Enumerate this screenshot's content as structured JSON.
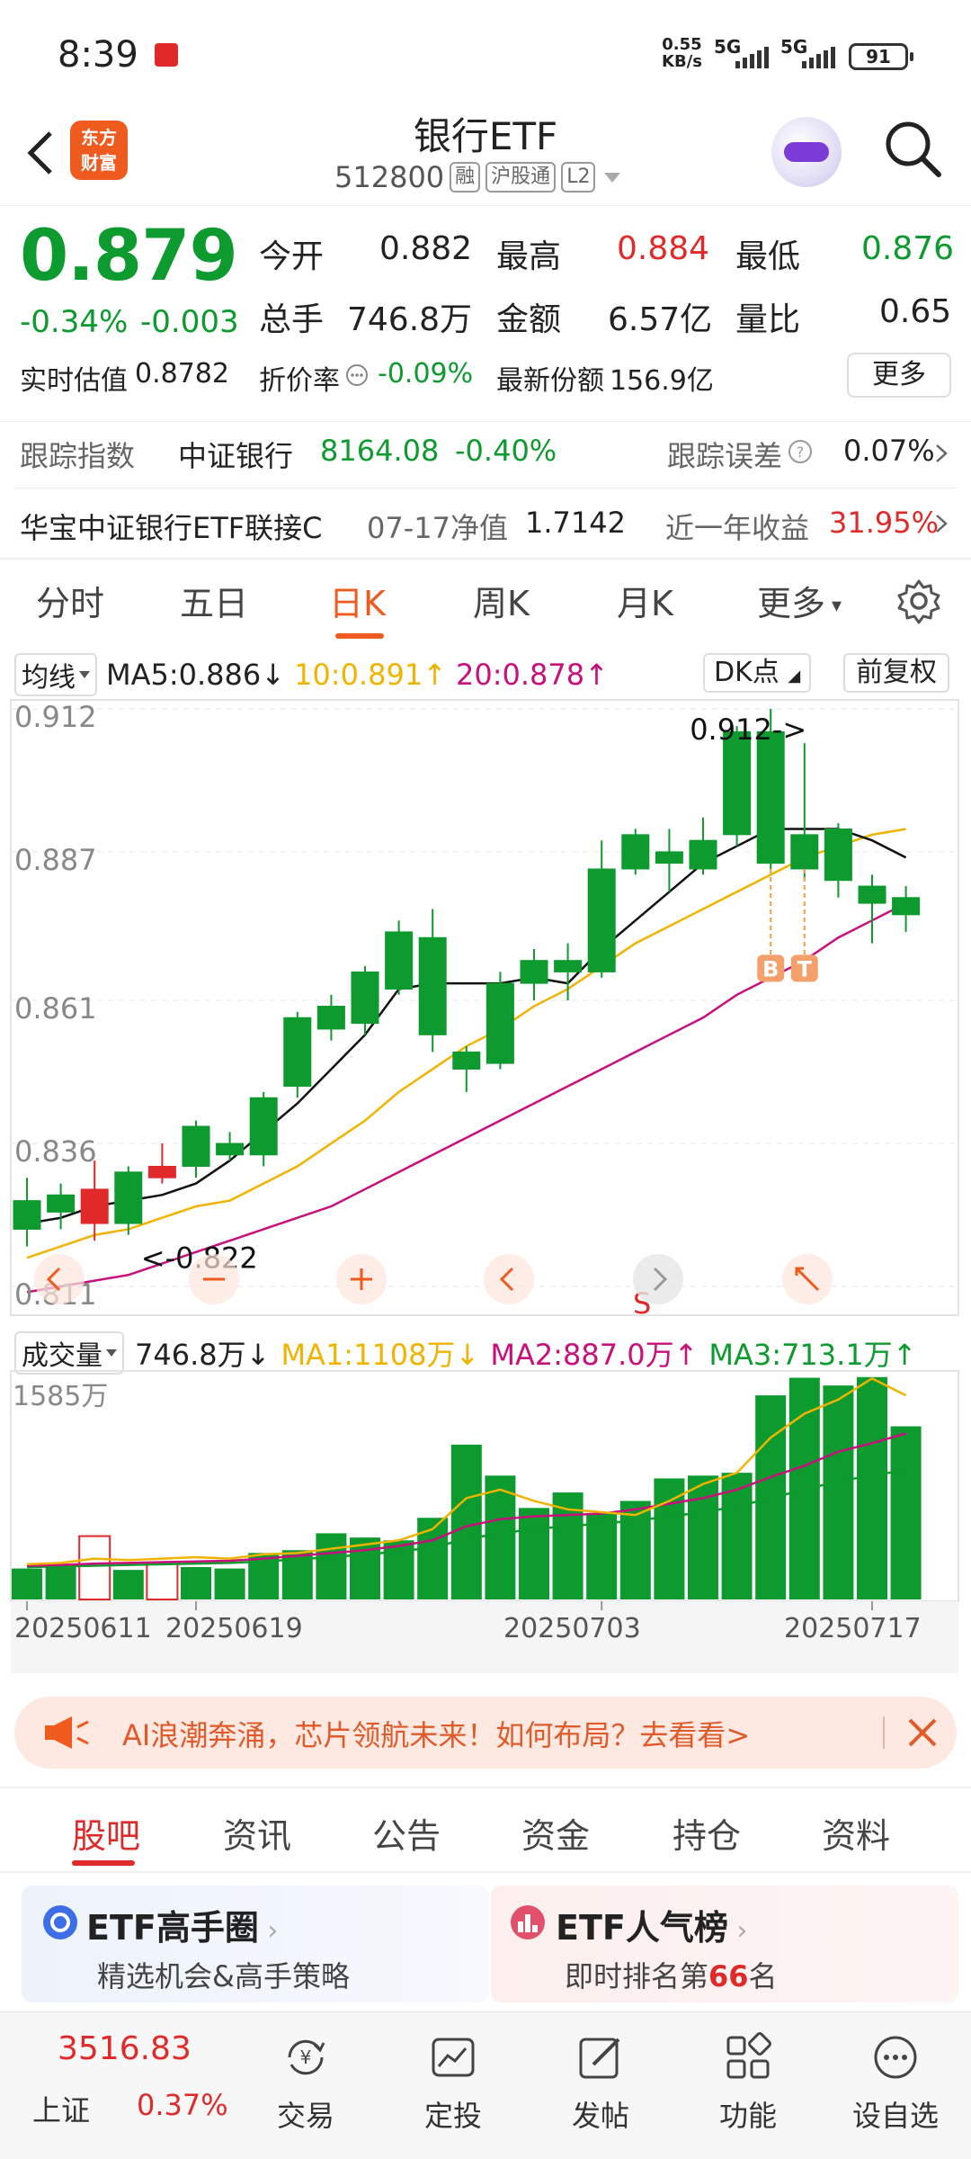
{
  "status_bar": {
    "time": "8:39",
    "net_speed": "0.55",
    "net_unit": "KB/s",
    "sig1": "5G",
    "sig2": "5G",
    "battery": "91"
  },
  "header": {
    "logo_line1": "东方",
    "logo_line2": "财富",
    "title": "银行ETF",
    "code": "512800",
    "tag_rong": "融",
    "tag_hgt": "沪股通",
    "tag_l2": "L2"
  },
  "quote": {
    "price": "0.879",
    "change_pct": "-0.34%",
    "change": "-0.003",
    "open_label": "今开",
    "open": "0.882",
    "high_label": "最高",
    "high": "0.884",
    "low_label": "最低",
    "low": "0.876",
    "volume_label": "总手",
    "volume": "746.8万",
    "amount_label": "金额",
    "amount": "6.57亿",
    "vol_ratio_label": "量比",
    "vol_ratio": "0.65",
    "iopv_label": "实时估值",
    "iopv": "0.8782",
    "premium_label": "折价率",
    "premium": "-0.09%",
    "shares_label": "最新份额",
    "shares": "156.9亿",
    "more": "更多"
  },
  "tracking": {
    "index_label": "跟踪指数",
    "index_name": "中证银行",
    "index_value": "8164.08",
    "index_change": "-0.40%",
    "error_label": "跟踪误差",
    "error_value": "0.07%",
    "fund_name": "华宝中证银行ETF联接C",
    "nav_date": "07-17净值",
    "nav": "1.7142",
    "yield_label": "近一年收益",
    "yield_value": "31.95%"
  },
  "ktabs": [
    "分时",
    "五日",
    "日K",
    "周K",
    "月K",
    "更多"
  ],
  "ma": {
    "select": "均线",
    "ma5": "MA5:0.886",
    "ma10": "10:0.891",
    "ma20": "20:0.878",
    "dk": "DK点",
    "fq": "前复权"
  },
  "vol_header": {
    "select": "成交量",
    "volume": "746.8万",
    "ma1": "MA1:1108万",
    "ma2": "MA2:887.0万",
    "ma3": "MA3:713.1万"
  },
  "chart_data": {
    "type": "candlestick",
    "price_axis": [
      "0.912",
      "0.887",
      "0.861",
      "0.836",
      "0.811"
    ],
    "annotations": {
      "high": "0.912->",
      "low": "<-0.822",
      "buy": "B",
      "take": "T",
      "sell": "S"
    },
    "dates": [
      "20250611",
      "20250619",
      "20250703",
      "20250717"
    ],
    "candles": [
      {
        "o": 0.826,
        "c": 0.821,
        "h": 0.83,
        "l": 0.818
      },
      {
        "o": 0.827,
        "c": 0.824,
        "h": 0.829,
        "l": 0.821
      },
      {
        "o": 0.822,
        "c": 0.828,
        "h": 0.833,
        "l": 0.819
      },
      {
        "o": 0.831,
        "c": 0.822,
        "h": 0.832,
        "l": 0.82
      },
      {
        "o": 0.83,
        "c": 0.832,
        "h": 0.836,
        "l": 0.829
      },
      {
        "o": 0.839,
        "c": 0.832,
        "h": 0.84,
        "l": 0.83
      },
      {
        "o": 0.836,
        "c": 0.834,
        "h": 0.838,
        "l": 0.833
      },
      {
        "o": 0.844,
        "c": 0.834,
        "h": 0.845,
        "l": 0.832
      },
      {
        "o": 0.858,
        "c": 0.846,
        "h": 0.859,
        "l": 0.844
      },
      {
        "o": 0.86,
        "c": 0.856,
        "h": 0.862,
        "l": 0.854
      },
      {
        "o": 0.866,
        "c": 0.857,
        "h": 0.867,
        "l": 0.855
      },
      {
        "o": 0.873,
        "c": 0.863,
        "h": 0.875,
        "l": 0.862
      },
      {
        "o": 0.872,
        "c": 0.855,
        "h": 0.877,
        "l": 0.852
      },
      {
        "o": 0.852,
        "c": 0.849,
        "h": 0.853,
        "l": 0.845
      },
      {
        "o": 0.864,
        "c": 0.85,
        "h": 0.866,
        "l": 0.849
      },
      {
        "o": 0.868,
        "c": 0.864,
        "h": 0.87,
        "l": 0.861
      },
      {
        "o": 0.868,
        "c": 0.866,
        "h": 0.871,
        "l": 0.861
      },
      {
        "o": 0.884,
        "c": 0.866,
        "h": 0.889,
        "l": 0.865
      },
      {
        "o": 0.89,
        "c": 0.884,
        "h": 0.891,
        "l": 0.883
      },
      {
        "o": 0.887,
        "c": 0.885,
        "h": 0.891,
        "l": 0.88
      },
      {
        "o": 0.889,
        "c": 0.884,
        "h": 0.893,
        "l": 0.883
      },
      {
        "o": 0.908,
        "c": 0.89,
        "h": 0.909,
        "l": 0.888
      },
      {
        "o": 0.908,
        "c": 0.885,
        "h": 0.912,
        "l": 0.884
      },
      {
        "o": 0.89,
        "c": 0.884,
        "h": 0.906,
        "l": 0.882
      },
      {
        "o": 0.891,
        "c": 0.882,
        "h": 0.892,
        "l": 0.879
      },
      {
        "o": 0.881,
        "c": 0.878,
        "h": 0.883,
        "l": 0.871
      },
      {
        "o": 0.879,
        "c": 0.876,
        "h": 0.881,
        "l": 0.873
      }
    ],
    "ma5": [
      0.822,
      0.823,
      0.825,
      0.826,
      0.827,
      0.829,
      0.833,
      0.838,
      0.843,
      0.849,
      0.855,
      0.863,
      0.864,
      0.864,
      0.864,
      0.865,
      0.864,
      0.87,
      0.875,
      0.88,
      0.885,
      0.888,
      0.891,
      0.891,
      0.891,
      0.889,
      0.886
    ],
    "ma10": [
      0.816,
      0.818,
      0.82,
      0.821,
      0.823,
      0.825,
      0.826,
      0.829,
      0.832,
      0.836,
      0.84,
      0.845,
      0.849,
      0.853,
      0.856,
      0.86,
      0.863,
      0.867,
      0.871,
      0.874,
      0.877,
      0.88,
      0.883,
      0.886,
      0.888,
      0.89,
      0.891
    ],
    "ma20": [
      0.81,
      0.811,
      0.812,
      0.813,
      0.815,
      0.817,
      0.819,
      0.821,
      0.823,
      0.825,
      0.828,
      0.831,
      0.834,
      0.837,
      0.84,
      0.843,
      0.846,
      0.849,
      0.852,
      0.855,
      0.858,
      0.862,
      0.865,
      0.868,
      0.872,
      0.875,
      0.878
    ],
    "volume_max_label": "1585万",
    "volume": [
      220,
      230,
      450,
      210,
      260,
      230,
      220,
      330,
      350,
      470,
      440,
      420,
      580,
      1100,
      880,
      650,
      760,
      610,
      700,
      860,
      880,
      900,
      1450,
      1575,
      1520,
      1580,
      1230
    ],
    "vol_ma1": [
      250,
      260,
      290,
      280,
      290,
      300,
      290,
      320,
      330,
      360,
      390,
      420,
      500,
      720,
      780,
      700,
      640,
      620,
      600,
      700,
      820,
      900,
      1150,
      1320,
      1420,
      1570,
      1450
    ],
    "vol_ma2": [
      240,
      245,
      255,
      260,
      265,
      270,
      275,
      290,
      310,
      330,
      350,
      380,
      420,
      520,
      570,
      590,
      600,
      610,
      640,
      680,
      720,
      780,
      870,
      950,
      1050,
      1110,
      1180
    ],
    "vol_ma3": [
      230,
      235,
      240,
      245,
      250,
      255,
      260,
      270,
      285,
      300,
      320,
      340,
      370,
      430,
      470,
      500,
      520,
      540,
      560,
      590,
      620,
      660,
      720,
      780,
      840,
      880,
      920
    ]
  },
  "banner": {
    "text": "AI浪潮奔涌，芯片领航未来！如何布局？去看看>"
  },
  "bottom_tabs": [
    "股吧",
    "资讯",
    "公告",
    "资金",
    "持仓",
    "资料"
  ],
  "cards": [
    {
      "title": "ETF高手圈",
      "desc": "精选机会&高手策略"
    },
    {
      "title": "ETF人气榜",
      "desc_prefix": "即时排名第",
      "desc_num": "66",
      "desc_suffix": "名"
    }
  ],
  "bottom_nav": {
    "index_value": "3516.83",
    "index_name": "上证",
    "index_change": "0.37%",
    "items": [
      "交易",
      "定投",
      "发帖",
      "功能",
      "设自选"
    ]
  },
  "colors": {
    "up": "#e02a2a",
    "down": "#0d9a2e",
    "accent": "#ef5a1e",
    "ma5": "#111111",
    "ma10": "#f0b400",
    "ma20": "#c8107d"
  }
}
